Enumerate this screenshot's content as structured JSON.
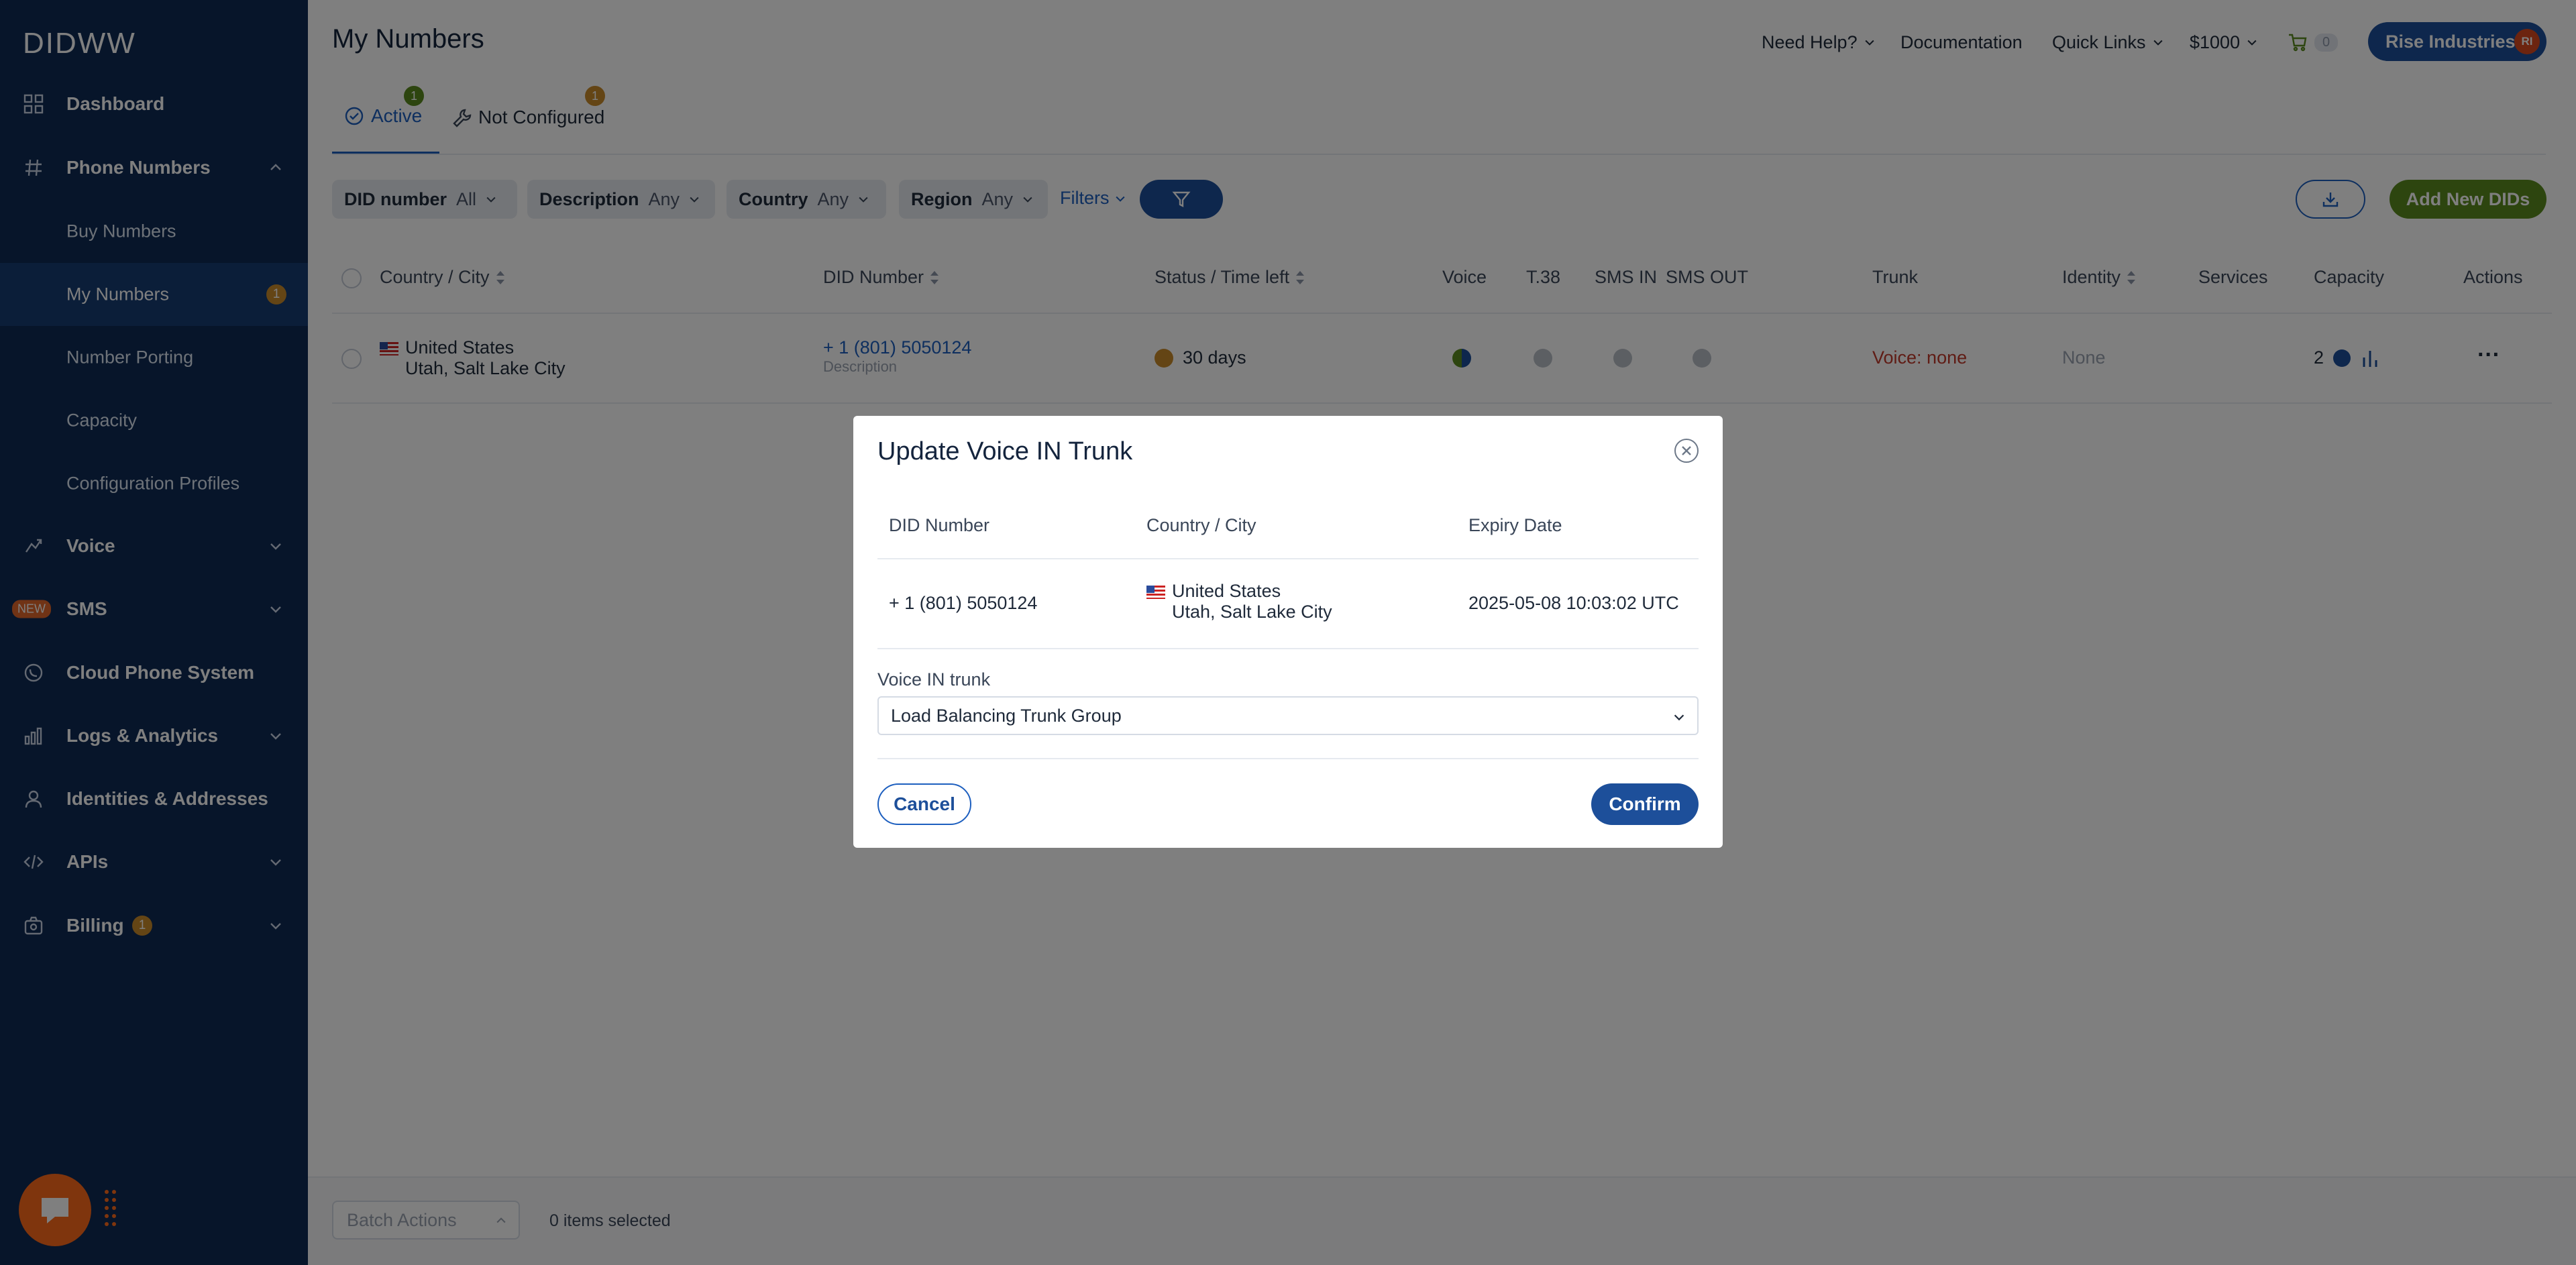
{
  "sidebar": {
    "logo": "DIDWW",
    "items": [
      {
        "label": "Dashboard"
      },
      {
        "label": "Phone Numbers"
      },
      {
        "label": "Voice"
      },
      {
        "label": "SMS",
        "tag": "NEW"
      },
      {
        "label": "Cloud Phone System"
      },
      {
        "label": "Logs & Analytics"
      },
      {
        "label": "Identities & Addresses"
      },
      {
        "label": "APIs"
      },
      {
        "label": "Billing",
        "badge": "1"
      }
    ],
    "phone_sub": [
      {
        "label": "Buy Numbers"
      },
      {
        "label": "My Numbers",
        "badge": "1"
      },
      {
        "label": "Number Porting"
      },
      {
        "label": "Capacity"
      },
      {
        "label": "Configuration Profiles"
      }
    ]
  },
  "header": {
    "title": "My Numbers",
    "need_help": "Need Help?",
    "documentation": "Documentation",
    "quick_links": "Quick Links",
    "balance": "$1000",
    "cart_count": "0",
    "company": "Rise Industries",
    "avatar_initials": "RI"
  },
  "tabs": [
    {
      "label": "Active",
      "badge": "1"
    },
    {
      "label": "Not Configured",
      "badge": "1"
    }
  ],
  "filters": {
    "did_number": {
      "label": "DID number",
      "value": "All"
    },
    "description": {
      "label": "Description",
      "value": "Any"
    },
    "country": {
      "label": "Country",
      "value": "Any"
    },
    "region": {
      "label": "Region",
      "value": "Any"
    },
    "filters_link": "Filters",
    "add_button": "Add New DIDs"
  },
  "table": {
    "headers": [
      "Country / City",
      "DID Number",
      "Status / Time left",
      "Voice",
      "T.38",
      "SMS IN",
      "SMS OUT",
      "Trunk",
      "Identity",
      "Services",
      "Capacity",
      "Actions"
    ],
    "rows": [
      {
        "country": "United States",
        "city": "Utah, Salt Lake City",
        "did": "+ 1 (801) 5050124",
        "did_desc": "Description",
        "status": "30 days",
        "trunk": "Voice: none",
        "identity": "None",
        "capacity": "2",
        "actions": "···"
      }
    ]
  },
  "footer": {
    "batch_placeholder": "Batch Actions",
    "selected": "0 items selected"
  },
  "modal": {
    "title": "Update Voice IN Trunk",
    "headers": [
      "DID Number",
      "Country / City",
      "Expiry Date"
    ],
    "did": "+ 1 (801) 5050124",
    "country": "United States",
    "city": "Utah, Salt Lake City",
    "expiry": "2025-05-08 10:03:02 UTC",
    "trunk_label": "Voice IN trunk",
    "trunk_value": "Load Balancing Trunk Group",
    "cancel": "Cancel",
    "confirm": "Confirm"
  },
  "colors": {
    "sidebar": "#0e2a55",
    "accent": "#1d4f9a",
    "add_button": "#5a8a1e",
    "status_orange": "#c98a2b",
    "trunk_error": "#c0392b"
  }
}
